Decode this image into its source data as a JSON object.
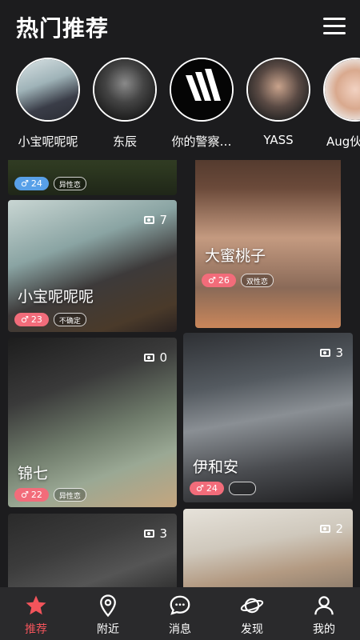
{
  "header": {
    "title": "热门推荐"
  },
  "stories": [
    {
      "name": "小宝呢呢呢"
    },
    {
      "name": "东辰"
    },
    {
      "name": "你的警察…"
    },
    {
      "name": "YASS"
    },
    {
      "name": "Aug伙"
    }
  ],
  "cards": [
    {
      "name": "",
      "count": "",
      "age": "24",
      "orientation": "异性恋",
      "gender": "male",
      "badge_color": "#58a0e8"
    },
    {
      "name": "",
      "count": "",
      "age": "",
      "orientation": "",
      "gender": "",
      "badge_color": ""
    },
    {
      "name": "小宝呢呢呢",
      "count": "7",
      "age": "23",
      "orientation": "不确定",
      "gender": "male"
    },
    {
      "name": "大蜜桃子",
      "count": "",
      "age": "26",
      "orientation": "双性恋",
      "gender": "male"
    },
    {
      "name": "锦七",
      "count": "0",
      "age": "22",
      "orientation": "异性恋",
      "gender": "male"
    },
    {
      "name": "伊和安",
      "count": "3",
      "age": "24",
      "orientation": "",
      "gender": "male"
    },
    {
      "name": "",
      "count": "3",
      "age": "",
      "orientation": ""
    },
    {
      "name": "",
      "count": "2",
      "age": "",
      "orientation": ""
    }
  ],
  "tabs": [
    {
      "label": "推荐",
      "icon": "star-icon",
      "active": true
    },
    {
      "label": "附近",
      "icon": "location-pin-icon"
    },
    {
      "label": "消息",
      "icon": "chat-bubble-icon"
    },
    {
      "label": "发现",
      "icon": "planet-icon"
    },
    {
      "label": "我的",
      "icon": "user-icon"
    }
  ],
  "colors": {
    "background": "#1c1c1e",
    "accent": "#f2545b",
    "age_badge": "#f26c7a",
    "age_badge_alt": "#58a0e8",
    "tabbar": "#2a2a2c"
  }
}
